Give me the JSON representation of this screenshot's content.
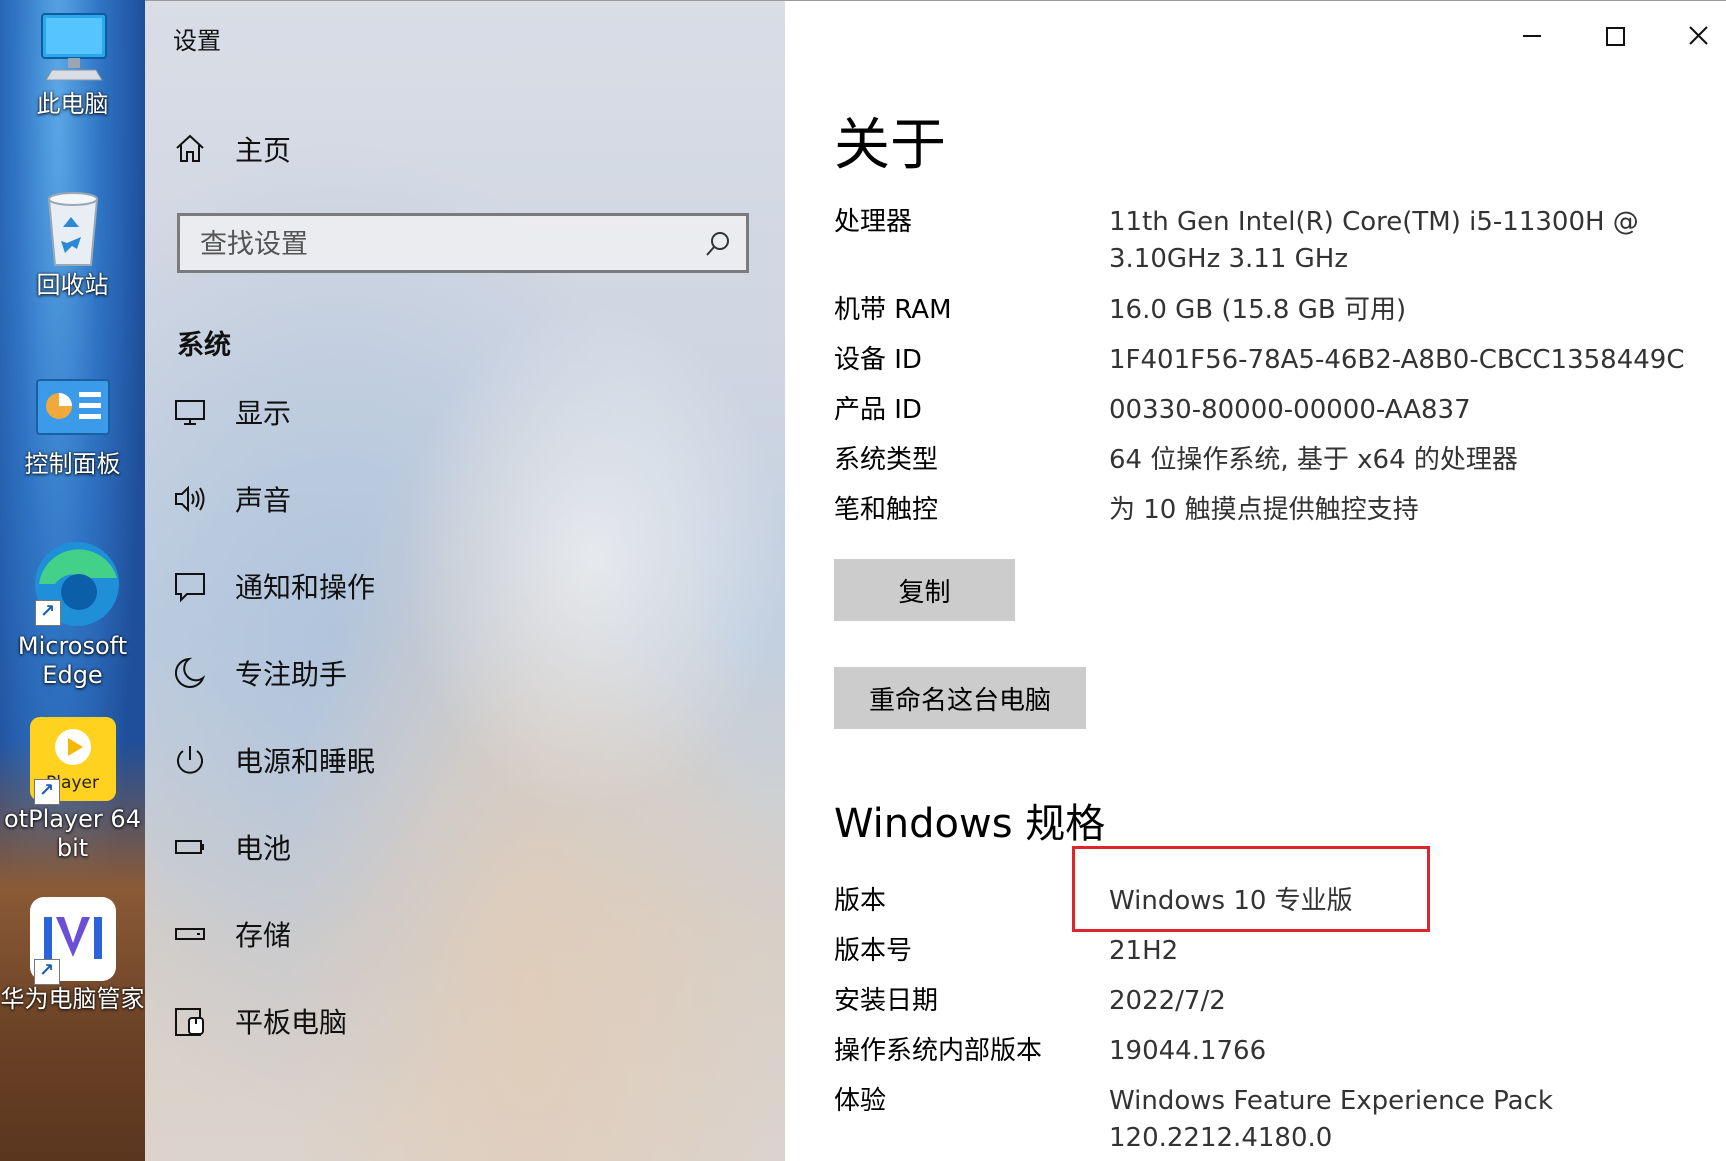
{
  "desktop": {
    "icons": [
      {
        "label": "此电脑",
        "icon": "this-pc-icon"
      },
      {
        "label": "回收站",
        "icon": "recycle-bin-icon"
      },
      {
        "label": "控制面板",
        "icon": "control-panel-icon"
      },
      {
        "label": "Microsoft\nEdge",
        "line1": "Microsoft",
        "line2": "Edge",
        "icon": "edge-icon"
      },
      {
        "label": "otPlayer 64 bit",
        "line1": "otPlayer 64",
        "line2": "bit",
        "badge": "Player",
        "icon": "potplayer-icon"
      },
      {
        "label": "华为电脑管家",
        "icon": "huawei-pc-manager-icon"
      }
    ]
  },
  "window": {
    "title": "设置",
    "caption": {
      "minimize": "minimize-icon",
      "maximize": "maximize-icon",
      "close": "close-icon"
    }
  },
  "nav": {
    "home": "主页",
    "search_placeholder": "查找设置",
    "section": "系统",
    "items": [
      {
        "label": "显示",
        "icon": "display-icon"
      },
      {
        "label": "声音",
        "icon": "sound-icon"
      },
      {
        "label": "通知和操作",
        "icon": "notifications-icon"
      },
      {
        "label": "专注助手",
        "icon": "focus-assist-icon"
      },
      {
        "label": "电源和睡眠",
        "icon": "power-icon"
      },
      {
        "label": "电池",
        "icon": "battery-icon"
      },
      {
        "label": "存储",
        "icon": "storage-icon"
      },
      {
        "label": "平板电脑",
        "icon": "tablet-icon"
      }
    ]
  },
  "about": {
    "title": "关于",
    "device_specs": [
      {
        "key": "处理器",
        "value": "11th Gen Intel(R) Core(TM) i5-11300H @ 3.10GHz   3.11 GHz"
      },
      {
        "key": "机带 RAM",
        "value": "16.0 GB (15.8 GB 可用)"
      },
      {
        "key": "设备 ID",
        "value": "1F401F56-78A5-46B2-A8B0-CBCC1358449C"
      },
      {
        "key": "产品 ID",
        "value": "00330-80000-00000-AA837"
      },
      {
        "key": "系统类型",
        "value": "64 位操作系统, 基于 x64 的处理器"
      },
      {
        "key": "笔和触控",
        "value": "为 10 触摸点提供触控支持"
      }
    ],
    "copy_button": "复制",
    "rename_button": "重命名这台电脑",
    "windows_title": "Windows 规格",
    "windows_specs": [
      {
        "key": "版本",
        "value": "Windows 10 专业版"
      },
      {
        "key": "版本号",
        "value": "21H2"
      },
      {
        "key": "安装日期",
        "value": "2022/7/2"
      },
      {
        "key": "操作系统内部版本",
        "value": "19044.1766"
      },
      {
        "key": "体验",
        "value": "Windows Feature Experience Pack 120.2212.4180.0"
      }
    ],
    "highlight_color": "#e0242e"
  }
}
